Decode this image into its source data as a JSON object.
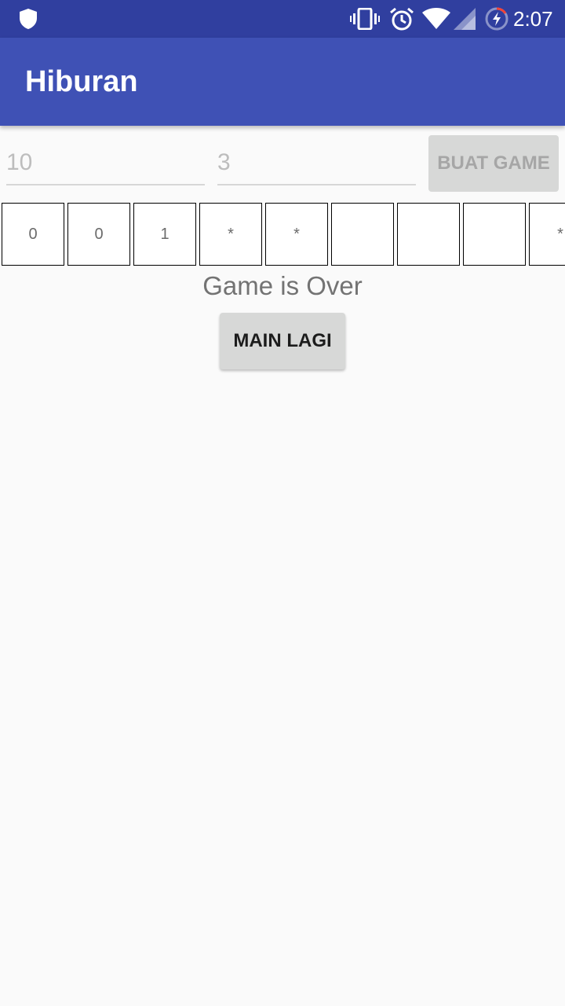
{
  "status_bar": {
    "time": "2:07",
    "icons": [
      "shield-icon",
      "vibrate-icon",
      "alarm-icon",
      "wifi-icon",
      "signal-icon",
      "battery-charging-icon"
    ]
  },
  "app_bar": {
    "title": "Hiburan"
  },
  "inputs": {
    "board_size_placeholder": "10",
    "mine_count_placeholder": "3"
  },
  "buttons": {
    "create_game": "BUAT GAME",
    "play_again": "MAIN LAGI"
  },
  "board": {
    "cells": [
      "0",
      "0",
      "1",
      "*",
      "*",
      "",
      "",
      "",
      "*"
    ]
  },
  "game": {
    "status": "Game is Over"
  },
  "colors": {
    "primary": "#3f51b5",
    "primary_dark": "#303f9f",
    "background": "#fafafa",
    "button": "#d7d8d7"
  }
}
